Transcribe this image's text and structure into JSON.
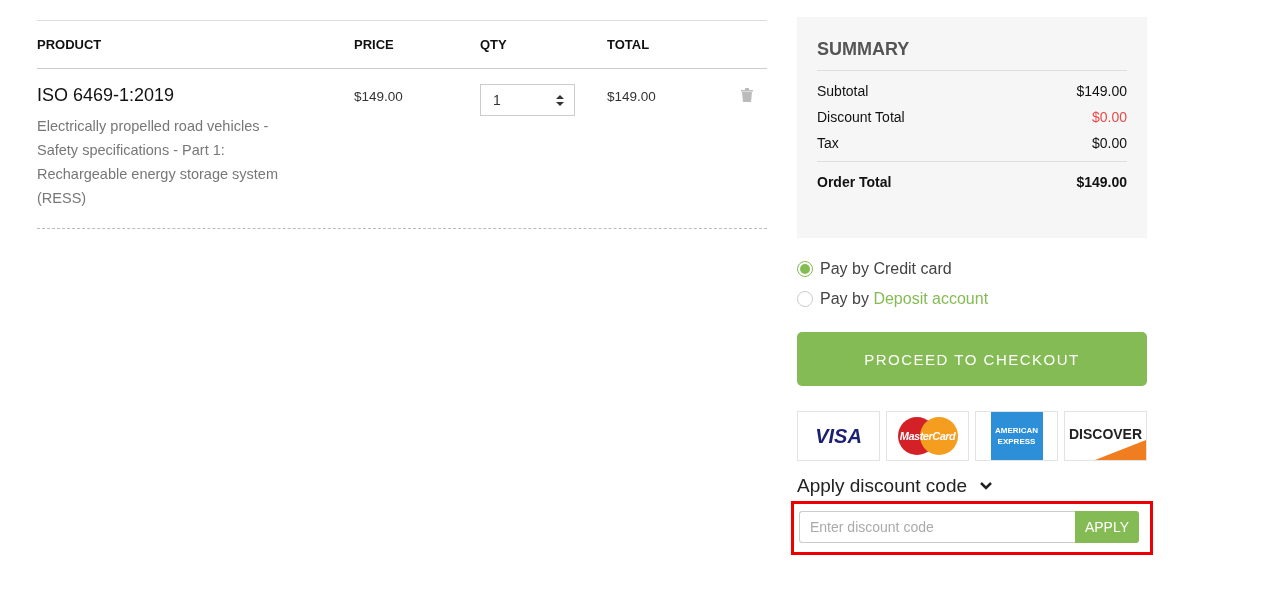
{
  "cart": {
    "columns": [
      "PRODUCT",
      "PRICE",
      "QTY",
      "TOTAL"
    ],
    "rows": [
      {
        "title": "ISO 6469-1:2019",
        "description": "Electrically propelled road vehicles - Safety specifications - Part 1: Rechargeable energy storage system (RESS)",
        "price": "$149.00",
        "qty": "1",
        "total": "$149.00"
      }
    ]
  },
  "summary": {
    "title": "SUMMARY",
    "lines": [
      {
        "label": "Subtotal",
        "value": "$149.00",
        "kind": "normal"
      },
      {
        "label": "Discount Total",
        "value": "$0.00",
        "kind": "discount"
      },
      {
        "label": "Tax",
        "value": "$0.00",
        "kind": "normal"
      }
    ],
    "total": {
      "label": "Order Total",
      "value": "$149.00"
    }
  },
  "payment_options": [
    {
      "prefix": "Pay by",
      "method": "Credit card",
      "method_is_link": false,
      "selected": true
    },
    {
      "prefix": "Pay by",
      "method": "Deposit account",
      "method_is_link": true,
      "selected": false
    }
  ],
  "checkout_button": "PROCEED TO CHECKOUT",
  "cards": [
    {
      "kind": "visa",
      "text": "VISA"
    },
    {
      "kind": "mastercard",
      "text": "MasterCard"
    },
    {
      "kind": "amex",
      "text": "AMERICAN EXPRESS"
    },
    {
      "kind": "discover",
      "text": "DISCOVER"
    }
  ],
  "discount": {
    "title": "Apply discount code",
    "expanded": true,
    "highlighted": true,
    "placeholder": "Enter discount code",
    "button": "APPLY"
  }
}
